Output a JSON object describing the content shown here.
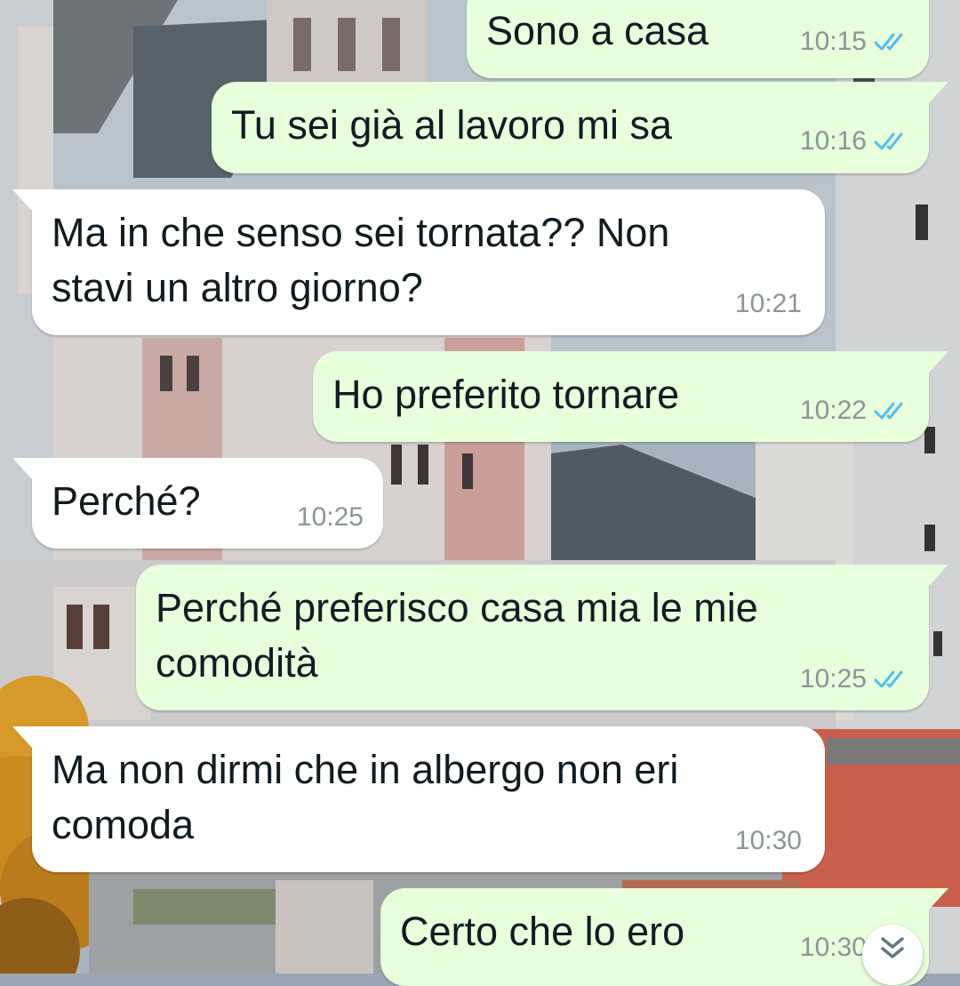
{
  "messages": [
    {
      "text_lines": [
        "Sono a casa"
      ],
      "time": "10:15",
      "status": "read"
    },
    {
      "text_lines": [
        "Tu sei già al lavoro mi sa"
      ],
      "time": "10:16",
      "status": "read"
    },
    {
      "text_lines": [
        "Ma in che senso sei tornata?? Non",
        "stavi un altro giorno?"
      ],
      "time": "10:21"
    },
    {
      "text_lines": [
        "Ho preferito tornare"
      ],
      "time": "10:22",
      "status": "read"
    },
    {
      "text_lines": [
        "Perché?"
      ],
      "time": "10:25"
    },
    {
      "text_lines": [
        "Perché preferisco casa mia le mie",
        "comodità"
      ],
      "time": "10:25",
      "status": "read"
    },
    {
      "text_lines": [
        "Ma non dirmi che in albergo non eri",
        "comoda"
      ],
      "time": "10:30"
    },
    {
      "text_lines": [
        "Certo che lo ero"
      ],
      "time": "10:30",
      "status": "read"
    }
  ],
  "colors": {
    "outgoing_bubble": "#e7ffdb",
    "incoming_bubble": "#ffffff",
    "read_ticks": "#53bdeb",
    "timestamp": "#8b9599"
  },
  "icons": {
    "read_ticks": "double-check-icon",
    "scroll_down": "double-chevron-down-icon"
  }
}
